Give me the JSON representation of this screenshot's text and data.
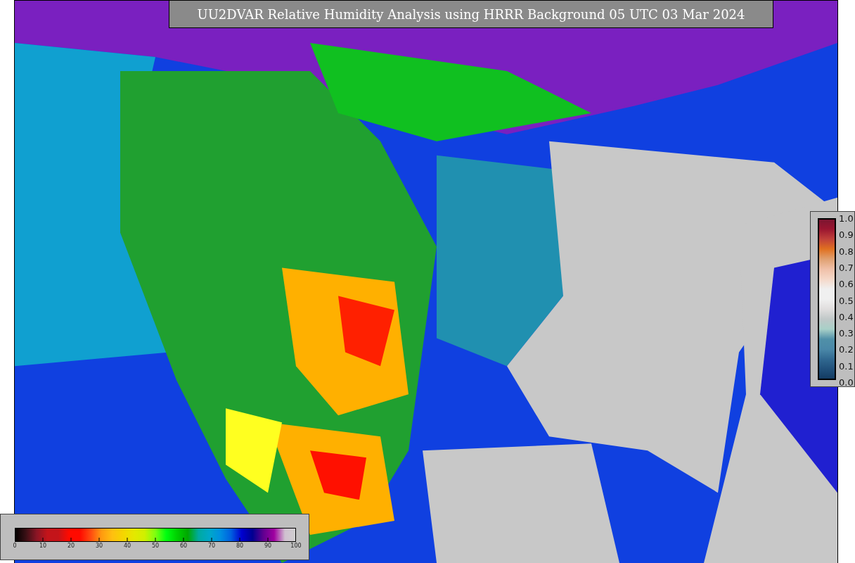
{
  "title": "UU2DVAR Relative Humidity Analysis using HRRR Background 05 UTC 03 Mar 2024",
  "humidity_colorbar": {
    "ticks": [
      "0",
      "10",
      "20",
      "30",
      "40",
      "50",
      "60",
      "70",
      "80",
      "90",
      "100"
    ]
  },
  "ratio_colorbar": {
    "ticks": [
      "1.0",
      "0.9",
      "0.8",
      "0.7",
      "0.6",
      "0.5",
      "0.4",
      "0.3",
      "0.2",
      "0.1",
      "0.0"
    ]
  }
}
